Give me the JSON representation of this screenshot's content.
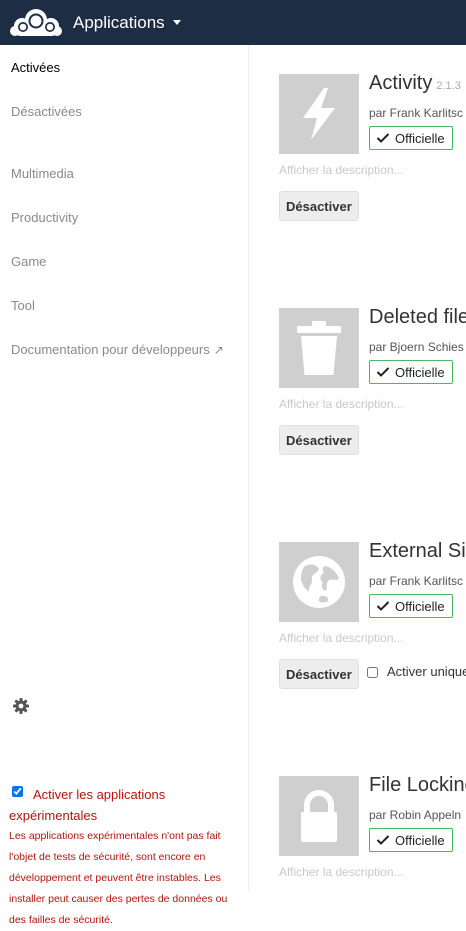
{
  "header": {
    "logo": "owncloud-logo",
    "app_menu_label": "Applications",
    "background": "#1d2d44"
  },
  "sidebar": {
    "items": [
      {
        "label": "Activées",
        "active": true
      },
      {
        "label": "Désactivées",
        "active": false
      },
      {
        "label": "Multimedia",
        "active": false
      },
      {
        "label": "Productivity",
        "active": false
      },
      {
        "label": "Game",
        "active": false
      },
      {
        "label": "Tool",
        "active": false
      }
    ],
    "dev_docs_label": "Documentation pour développeurs",
    "dev_docs_icon": "external-link-arrow-icon",
    "settings_icon": "gear-icon",
    "experimental": {
      "checked": true,
      "label": "Activer les applications expérimentales",
      "warning": "Les applications expérimentales n'ont pas fait l'objet de tests de sécurité, sont encore en développement et peuvent être instables. Les installer peut causer des pertes de données ou des failles de sécurité.",
      "color": "#b3150d"
    }
  },
  "apps": [
    {
      "name": "Activity",
      "version": "2.1.3",
      "author": "par Frank Karlitsc",
      "badge": "Officielle",
      "description_link": "Afficher la description...",
      "button": "Désactiver",
      "icon": "lightning-icon"
    },
    {
      "name": "Deleted file",
      "version": "",
      "author": "par Bjoern Schies",
      "badge": "Officielle",
      "description_link": "Afficher la description...",
      "button": "Désactiver",
      "icon": "trash-icon"
    },
    {
      "name": "External Sit",
      "version": "",
      "author": "par Frank Karlitsc",
      "badge": "Officielle",
      "description_link": "Afficher la description...",
      "button": "Désactiver",
      "icon": "globe-icon",
      "group_toggle_label": "Activer unique"
    },
    {
      "name": "File Locking",
      "version": "",
      "author": "par Robin Appeln",
      "badge": "Officielle",
      "description_link": "Afficher la description...",
      "icon": "lock-icon"
    }
  ],
  "colors": {
    "badge_border": "#46ba61",
    "icon_background": "#cfcfcf"
  }
}
